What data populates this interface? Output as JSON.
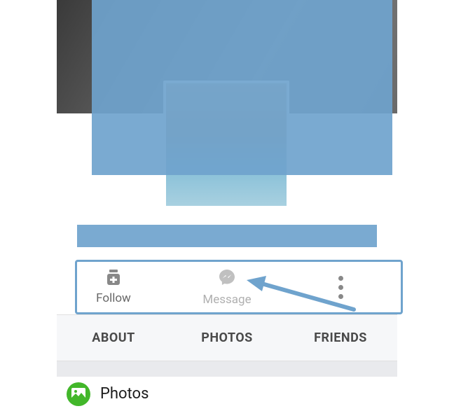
{
  "actions": {
    "follow": {
      "label": "Follow",
      "icon": "follow-icon"
    },
    "message": {
      "label": "Message",
      "icon": "messenger-icon"
    },
    "more": {
      "icon": "more-icon"
    }
  },
  "tabs": [
    {
      "label": "ABOUT"
    },
    {
      "label": "PHOTOS"
    },
    {
      "label": "FRIENDS"
    }
  ],
  "photos_section": {
    "title": "Photos",
    "icon": "photos-icon"
  },
  "colors": {
    "overlay_blue": "#6fa3cd",
    "photos_green": "#42b72a"
  }
}
